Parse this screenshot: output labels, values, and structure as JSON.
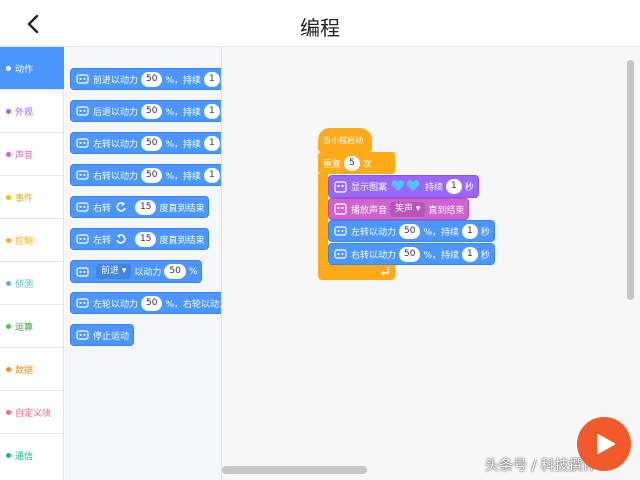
{
  "header": {
    "title": "编程"
  },
  "categories": [
    {
      "label": "动作",
      "color": "#4c97ff",
      "active": true
    },
    {
      "label": "外观",
      "color": "#9966ff"
    },
    {
      "label": "声音",
      "color": "#cf63cf"
    },
    {
      "label": "事件",
      "color": "#ffbf00"
    },
    {
      "label": "控制",
      "color": "#ffab19"
    },
    {
      "label": "侦测",
      "color": "#5cb1d6"
    },
    {
      "label": "运算",
      "color": "#59c059"
    },
    {
      "label": "数据",
      "color": "#ff8c1a"
    },
    {
      "label": "自定义块",
      "color": "#ff6680"
    },
    {
      "label": "通信",
      "color": "#0fbd8c"
    }
  ],
  "palette": {
    "forward": {
      "text": "前进以动力",
      "power": "50",
      "unit": "%，持续",
      "dur": "1"
    },
    "backward": {
      "text": "后退以动力",
      "power": "50",
      "unit": "%，持续",
      "dur": "1"
    },
    "left": {
      "text": "左转以动力",
      "power": "50",
      "unit": "%，持续",
      "dur": "1"
    },
    "right": {
      "text": "右转以动力",
      "power": "50",
      "unit": "%，持续",
      "dur": "1"
    },
    "turn_right": {
      "text": "右转",
      "deg": "15",
      "suffix": "度直到结束"
    },
    "turn_left": {
      "text": "左转",
      "deg": "15",
      "suffix": "度直到结束"
    },
    "direction": {
      "option": "前进",
      "text": "以动力",
      "power": "50",
      "unit": "%"
    },
    "wheels": {
      "text": "左轮以动力",
      "power": "50",
      "suffix": "%，右轮以动力"
    },
    "stop": {
      "text": "停止运动"
    }
  },
  "script": {
    "hat": "当小程启动",
    "repeat": {
      "text": "重复",
      "count": "5",
      "suffix": "次"
    },
    "show": {
      "text": "显示图案",
      "dur_label": "持续",
      "dur": "1",
      "unit": "秒"
    },
    "sound": {
      "text": "播放声音",
      "option": "笑声",
      "suffix": "直到结束"
    },
    "left": {
      "text": "左转以动力",
      "power": "50",
      "unit": "%，持续",
      "dur": "1",
      "sec": "秒"
    },
    "right": {
      "text": "右转以动力",
      "power": "50",
      "unit": "%，持续",
      "dur": "1",
      "sec": "秒"
    }
  },
  "watermark": "头条号 / 科技撰评"
}
